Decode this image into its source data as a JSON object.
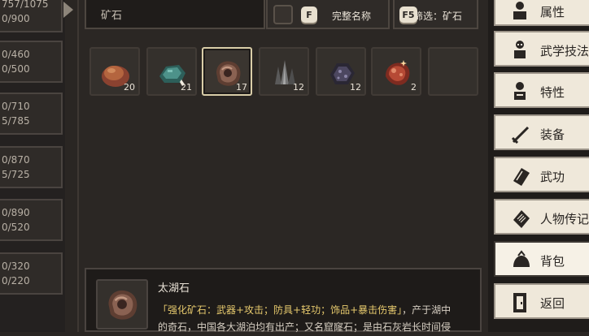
{
  "left_panel": {
    "cards": [
      {
        "line1": "757/1075",
        "line2": "0/900"
      },
      {
        "line1": "0/460",
        "line2": "0/500"
      },
      {
        "line1": "0/710",
        "line2": "5/785"
      },
      {
        "line1": "0/870",
        "line2": "5/725"
      },
      {
        "line1": "0/890",
        "line2": "0/520"
      },
      {
        "line1": "0/320",
        "line2": "0/220"
      }
    ]
  },
  "toolbar": {
    "search_text": "矿石",
    "full_name_key": "F",
    "full_name_label": "完整名称",
    "filter_key": "F5",
    "filter_label": "筛选：矿石"
  },
  "inventory": {
    "items": [
      {
        "icon": "brown-ore-icon",
        "count": "20",
        "color": "#a4553a"
      },
      {
        "icon": "teal-ore-icon",
        "count": "21",
        "color": "#3f7a73"
      },
      {
        "icon": "taihu-stone-icon",
        "count": "17",
        "color": "#7a5444"
      },
      {
        "icon": "dark-crystal-icon",
        "count": "12",
        "color": "#4a4a4a"
      },
      {
        "icon": "purple-ore-icon",
        "count": "12",
        "color": "#3d3a4a"
      },
      {
        "icon": "red-ore-icon",
        "count": "2",
        "color": "#a33a2a"
      },
      {
        "icon": "empty-slot",
        "count": "",
        "color": ""
      }
    ],
    "selected_index": 2
  },
  "detail": {
    "name": "太湖石",
    "desc_highlight": "「强化矿石：武器+攻击；防具+轻功；饰品+暴击伤害」",
    "desc_text_1": "，产于湖中",
    "desc_text_2": "的奇石，中国各大湖泊均有出产；又名窟窿石；是由石灰岩长时间侵"
  },
  "sidebar": {
    "items": [
      {
        "label": "属性",
        "icon": "person-icon"
      },
      {
        "label": "武学技法",
        "icon": "skill-figure-icon"
      },
      {
        "label": "特性",
        "icon": "trait-figure-icon"
      },
      {
        "label": "装备",
        "icon": "sword-icon"
      },
      {
        "label": "武功",
        "icon": "book-icon"
      },
      {
        "label": "人物传记",
        "icon": "scroll-icon"
      },
      {
        "label": "背包",
        "icon": "bag-icon"
      },
      {
        "label": "返回",
        "icon": "door-icon"
      }
    ],
    "active_index": 6
  },
  "colors": {
    "accent_highlight": "#e6c96d",
    "panel_bg": "#2b2724",
    "side_bg": "#efe8da"
  }
}
